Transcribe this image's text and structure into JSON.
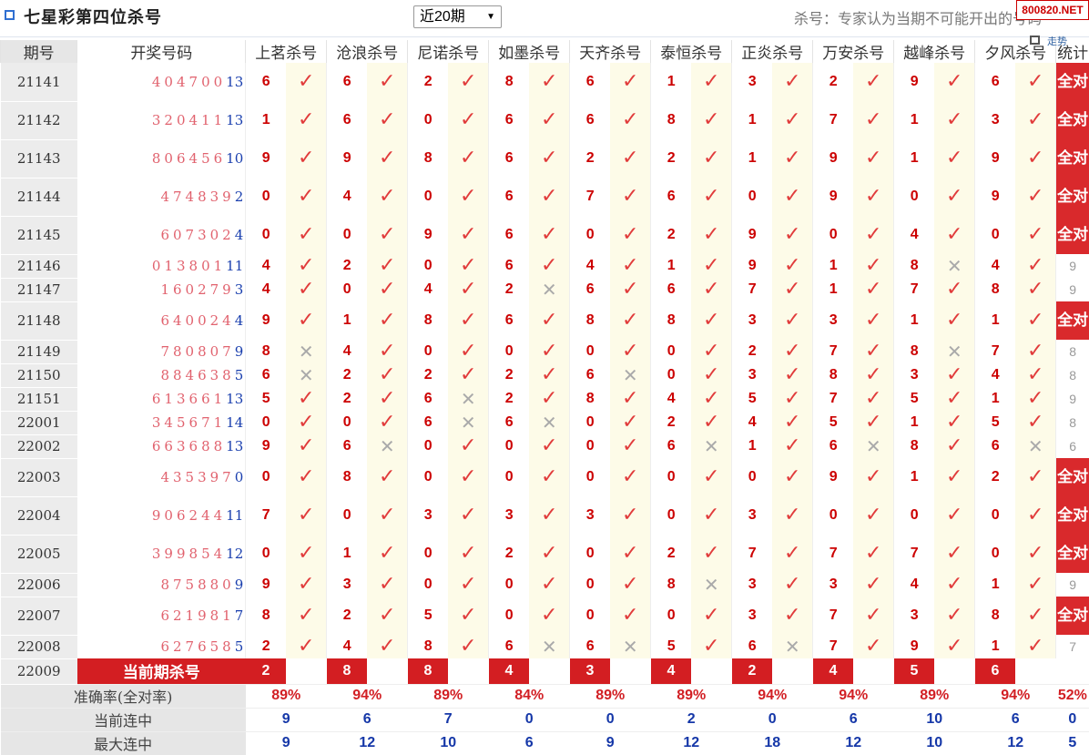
{
  "header": {
    "title": "七星彩第四位杀号",
    "period_select": "近20期",
    "note": "杀号：专家认为当期不可能开出的号码",
    "logo": "800820.NET",
    "chart_link": "走势"
  },
  "columns": {
    "period": "期号",
    "draw": "开奖号码",
    "experts": [
      "上茗杀号",
      "沧浪杀号",
      "尼诺杀号",
      "如墨杀号",
      "天齐杀号",
      "泰恒杀号",
      "正炎杀号",
      "万安杀号",
      "越峰杀号",
      "夕风杀号"
    ],
    "stat": "统计"
  },
  "rows": [
    {
      "period": "21141",
      "draw": "404700",
      "last": "13",
      "kills": [
        "6",
        "6",
        "2",
        "8",
        "6",
        "1",
        "3",
        "2",
        "9",
        "6"
      ],
      "marks": [
        1,
        1,
        1,
        1,
        1,
        1,
        1,
        1,
        1,
        1
      ],
      "stat": "全对"
    },
    {
      "period": "21142",
      "draw": "320411",
      "last": "13",
      "kills": [
        "1",
        "6",
        "0",
        "6",
        "6",
        "8",
        "1",
        "7",
        "1",
        "3"
      ],
      "marks": [
        1,
        1,
        1,
        1,
        1,
        1,
        1,
        1,
        1,
        1
      ],
      "stat": "全对"
    },
    {
      "period": "21143",
      "draw": "806456",
      "last": "10",
      "kills": [
        "9",
        "9",
        "8",
        "6",
        "2",
        "2",
        "1",
        "9",
        "1",
        "9"
      ],
      "marks": [
        1,
        1,
        1,
        1,
        1,
        1,
        1,
        1,
        1,
        1
      ],
      "stat": "全对"
    },
    {
      "period": "21144",
      "draw": "474839",
      "last": "2",
      "kills": [
        "0",
        "4",
        "0",
        "6",
        "7",
        "6",
        "0",
        "9",
        "0",
        "9"
      ],
      "marks": [
        1,
        1,
        1,
        1,
        1,
        1,
        1,
        1,
        1,
        1
      ],
      "stat": "全对"
    },
    {
      "period": "21145",
      "draw": "607302",
      "last": "4",
      "kills": [
        "0",
        "0",
        "9",
        "6",
        "0",
        "2",
        "9",
        "0",
        "4",
        "0"
      ],
      "marks": [
        1,
        1,
        1,
        1,
        1,
        1,
        1,
        1,
        1,
        1
      ],
      "stat": "全对"
    },
    {
      "period": "21146",
      "draw": "013801",
      "last": "11",
      "kills": [
        "4",
        "2",
        "0",
        "6",
        "4",
        "1",
        "9",
        "1",
        "8",
        "4"
      ],
      "marks": [
        1,
        1,
        1,
        1,
        1,
        1,
        1,
        1,
        0,
        1
      ],
      "stat": "9"
    },
    {
      "period": "21147",
      "draw": "160279",
      "last": "3",
      "kills": [
        "4",
        "0",
        "4",
        "2",
        "6",
        "6",
        "7",
        "1",
        "7",
        "8"
      ],
      "marks": [
        1,
        1,
        1,
        0,
        1,
        1,
        1,
        1,
        1,
        1
      ],
      "stat": "9"
    },
    {
      "period": "21148",
      "draw": "640024",
      "last": "4",
      "kills": [
        "9",
        "1",
        "8",
        "6",
        "8",
        "8",
        "3",
        "3",
        "1",
        "1"
      ],
      "marks": [
        1,
        1,
        1,
        1,
        1,
        1,
        1,
        1,
        1,
        1
      ],
      "stat": "全对"
    },
    {
      "period": "21149",
      "draw": "780807",
      "last": "9",
      "kills": [
        "8",
        "4",
        "0",
        "0",
        "0",
        "0",
        "2",
        "7",
        "8",
        "7"
      ],
      "marks": [
        0,
        1,
        1,
        1,
        1,
        1,
        1,
        1,
        0,
        1
      ],
      "stat": "8"
    },
    {
      "period": "21150",
      "draw": "884638",
      "last": "5",
      "kills": [
        "6",
        "2",
        "2",
        "2",
        "6",
        "0",
        "3",
        "8",
        "3",
        "4"
      ],
      "marks": [
        0,
        1,
        1,
        1,
        0,
        1,
        1,
        1,
        1,
        1
      ],
      "stat": "8"
    },
    {
      "period": "21151",
      "draw": "613661",
      "last": "13",
      "kills": [
        "5",
        "2",
        "6",
        "2",
        "8",
        "4",
        "5",
        "7",
        "5",
        "1"
      ],
      "marks": [
        1,
        1,
        0,
        1,
        1,
        1,
        1,
        1,
        1,
        1
      ],
      "stat": "9"
    },
    {
      "period": "22001",
      "draw": "345671",
      "last": "14",
      "kills": [
        "0",
        "0",
        "6",
        "6",
        "0",
        "2",
        "4",
        "5",
        "1",
        "5"
      ],
      "marks": [
        1,
        1,
        0,
        0,
        1,
        1,
        1,
        1,
        1,
        1
      ],
      "stat": "8"
    },
    {
      "period": "22002",
      "draw": "663688",
      "last": "13",
      "kills": [
        "9",
        "6",
        "0",
        "0",
        "0",
        "6",
        "1",
        "6",
        "8",
        "6"
      ],
      "marks": [
        1,
        0,
        1,
        1,
        1,
        0,
        1,
        0,
        1,
        0
      ],
      "stat": "6"
    },
    {
      "period": "22003",
      "draw": "435397",
      "last": "0",
      "kills": [
        "0",
        "8",
        "0",
        "0",
        "0",
        "0",
        "0",
        "9",
        "1",
        "2"
      ],
      "marks": [
        1,
        1,
        1,
        1,
        1,
        1,
        1,
        1,
        1,
        1
      ],
      "stat": "全对"
    },
    {
      "period": "22004",
      "draw": "906244",
      "last": "11",
      "kills": [
        "7",
        "0",
        "3",
        "3",
        "3",
        "0",
        "3",
        "0",
        "0",
        "0"
      ],
      "marks": [
        1,
        1,
        1,
        1,
        1,
        1,
        1,
        1,
        1,
        1
      ],
      "stat": "全对"
    },
    {
      "period": "22005",
      "draw": "399854",
      "last": "12",
      "kills": [
        "0",
        "1",
        "0",
        "2",
        "0",
        "2",
        "7",
        "7",
        "7",
        "0"
      ],
      "marks": [
        1,
        1,
        1,
        1,
        1,
        1,
        1,
        1,
        1,
        1
      ],
      "stat": "全对"
    },
    {
      "period": "22006",
      "draw": "875880",
      "last": "9",
      "kills": [
        "9",
        "3",
        "0",
        "0",
        "0",
        "8",
        "3",
        "3",
        "4",
        "1"
      ],
      "marks": [
        1,
        1,
        1,
        1,
        1,
        0,
        1,
        1,
        1,
        1
      ],
      "stat": "9"
    },
    {
      "period": "22007",
      "draw": "621981",
      "last": "7",
      "kills": [
        "8",
        "2",
        "5",
        "0",
        "0",
        "0",
        "3",
        "7",
        "3",
        "8"
      ],
      "marks": [
        1,
        1,
        1,
        1,
        1,
        1,
        1,
        1,
        1,
        1
      ],
      "stat": "全对"
    },
    {
      "period": "22008",
      "draw": "627658",
      "last": "5",
      "kills": [
        "2",
        "4",
        "8",
        "6",
        "6",
        "5",
        "6",
        "7",
        "9",
        "1"
      ],
      "marks": [
        1,
        1,
        1,
        0,
        0,
        1,
        0,
        1,
        1,
        1
      ],
      "stat": "7"
    }
  ],
  "current": {
    "period": "22009",
    "label": "当前期杀号",
    "kills": [
      "2",
      "8",
      "8",
      "4",
      "3",
      "4",
      "2",
      "4",
      "5",
      "6"
    ]
  },
  "summary": {
    "accuracy": {
      "label": "准确率(全对率)",
      "values": [
        "89%",
        "94%",
        "89%",
        "84%",
        "89%",
        "89%",
        "94%",
        "94%",
        "89%",
        "94%"
      ],
      "stat": "52%"
    },
    "current_streak": {
      "label": "当前连中",
      "values": [
        "9",
        "6",
        "7",
        "0",
        "0",
        "2",
        "0",
        "6",
        "10",
        "6"
      ],
      "stat": "0"
    },
    "max_streak": {
      "label": "最大连中",
      "values": [
        "9",
        "12",
        "10",
        "6",
        "9",
        "12",
        "18",
        "12",
        "10",
        "12"
      ],
      "stat": "5"
    }
  },
  "marks": {
    "hit": "✓",
    "miss": "✕"
  },
  "colors": {
    "kill_number": "#cc0000",
    "hit_mark": "#e13b3b",
    "miss_mark": "#aaaaaa",
    "current_row": "#d31e22",
    "full_badge": "#d9292c",
    "mark_bg": "#fdfbe8"
  }
}
